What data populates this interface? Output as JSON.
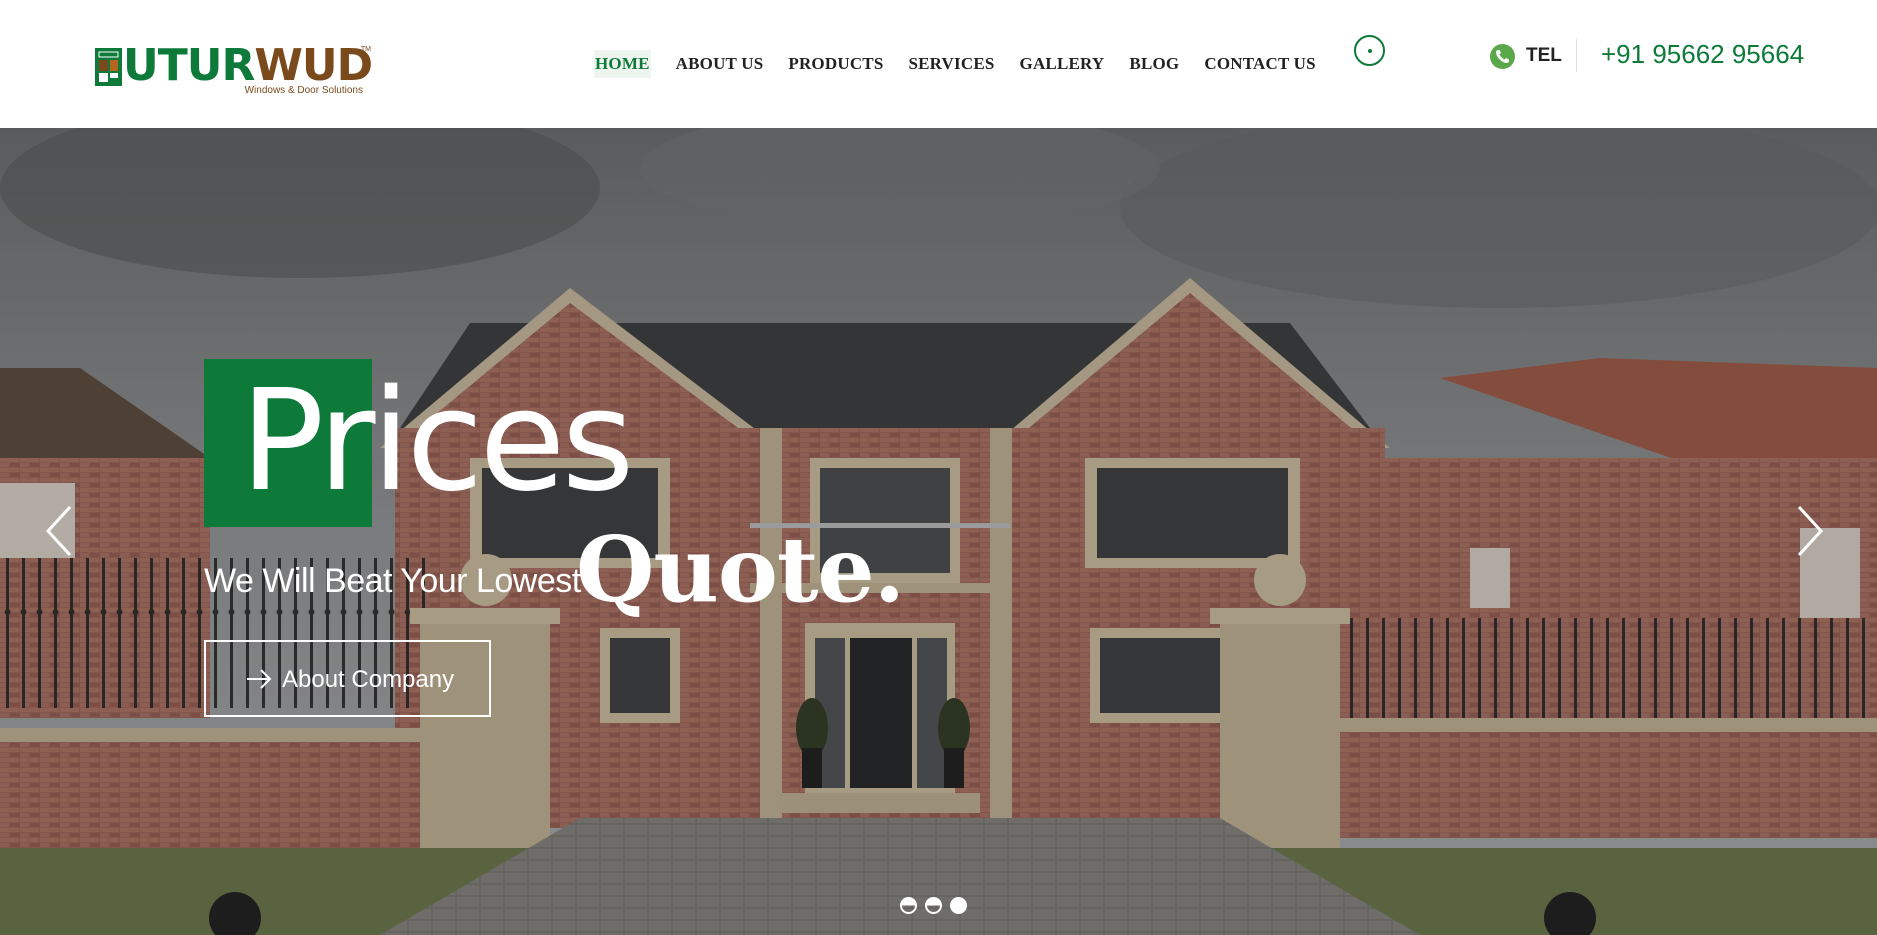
{
  "brand": {
    "logo_main_tail_green": "UTUR",
    "logo_main_tail_brown": "WUD",
    "logo_tagline": "Windows & Door Solutions",
    "logo_tm": "TM",
    "colors": {
      "green": "#0d7a3a",
      "brown": "#7a4a1c",
      "phone_icon": "#5aa84a"
    }
  },
  "nav": {
    "items": [
      {
        "label": "HOME",
        "active": true
      },
      {
        "label": "ABOUT US"
      },
      {
        "label": "PRODUCTS"
      },
      {
        "label": "SERVICES"
      },
      {
        "label": "GALLERY"
      },
      {
        "label": "BLOG"
      },
      {
        "label": "CONTACT US"
      }
    ]
  },
  "header_icons": {
    "location": "location-pin-icon",
    "phone": "phone-icon"
  },
  "contact": {
    "tel_label": "TEL",
    "phone": "+91 95662 95664"
  },
  "hero": {
    "headline": "Prices",
    "subline": "We Will Beat Your Lowest",
    "emphasis": "Quote.",
    "button_label": "About Company",
    "button_icon": "arrow-right-icon",
    "prev_icon": "chevron-left-icon",
    "next_icon": "chevron-right-icon",
    "slides": 3,
    "active_slide": 3
  }
}
